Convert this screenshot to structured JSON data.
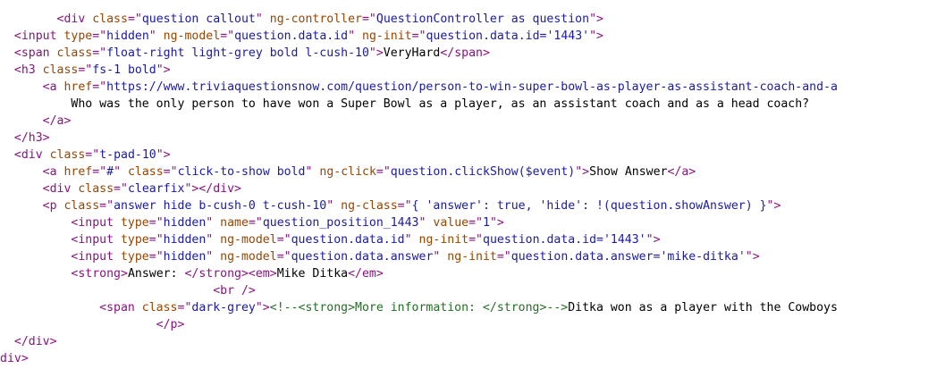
{
  "lines": [
    {
      "indent": "        ",
      "segs": [
        {
          "t": "tag",
          "v": "<div "
        },
        {
          "t": "attr",
          "v": "class"
        },
        {
          "t": "tag",
          "v": "=\""
        },
        {
          "t": "val",
          "v": "question callout"
        },
        {
          "t": "tag",
          "v": "\" "
        },
        {
          "t": "attr",
          "v": "ng-controller"
        },
        {
          "t": "tag",
          "v": "=\""
        },
        {
          "t": "val",
          "v": "QuestionController as question"
        },
        {
          "t": "tag",
          "v": "\">"
        }
      ]
    },
    {
      "indent": "  ",
      "segs": [
        {
          "t": "tag",
          "v": "<input "
        },
        {
          "t": "attr",
          "v": "type"
        },
        {
          "t": "tag",
          "v": "=\""
        },
        {
          "t": "val",
          "v": "hidden"
        },
        {
          "t": "tag",
          "v": "\" "
        },
        {
          "t": "attr",
          "v": "ng-model"
        },
        {
          "t": "tag",
          "v": "=\""
        },
        {
          "t": "val",
          "v": "question.data.id"
        },
        {
          "t": "tag",
          "v": "\" "
        },
        {
          "t": "attr",
          "v": "ng-init"
        },
        {
          "t": "tag",
          "v": "=\""
        },
        {
          "t": "val",
          "v": "question.data.id='1443'"
        },
        {
          "t": "tag",
          "v": "\">"
        }
      ]
    },
    {
      "indent": "  ",
      "segs": [
        {
          "t": "tag",
          "v": "<span "
        },
        {
          "t": "attr",
          "v": "class"
        },
        {
          "t": "tag",
          "v": "=\""
        },
        {
          "t": "val",
          "v": "float-right light-grey bold l-cush-10"
        },
        {
          "t": "tag",
          "v": "\">"
        },
        {
          "t": "txt",
          "v": "VeryHard"
        },
        {
          "t": "tag",
          "v": "</span>"
        }
      ]
    },
    {
      "indent": "  ",
      "segs": [
        {
          "t": "tag",
          "v": "<h3 "
        },
        {
          "t": "attr",
          "v": "class"
        },
        {
          "t": "tag",
          "v": "=\""
        },
        {
          "t": "val",
          "v": "fs-1 bold"
        },
        {
          "t": "tag",
          "v": "\">"
        }
      ]
    },
    {
      "indent": "      ",
      "segs": [
        {
          "t": "tag",
          "v": "<a "
        },
        {
          "t": "attr",
          "v": "href"
        },
        {
          "t": "tag",
          "v": "=\""
        },
        {
          "t": "val",
          "v": "https://www.triviaquestionsnow.com/question/person-to-win-super-bowl-as-player-as-assistant-coach-and-a"
        }
      ]
    },
    {
      "indent": "          ",
      "segs": [
        {
          "t": "txt",
          "v": "Who was the only person to have won a Super Bowl as a player, as an assistant coach and as a head coach?"
        }
      ]
    },
    {
      "indent": "      ",
      "segs": [
        {
          "t": "tag",
          "v": "</a>"
        }
      ]
    },
    {
      "indent": "  ",
      "segs": [
        {
          "t": "tag",
          "v": "</h3>"
        }
      ]
    },
    {
      "indent": "  ",
      "segs": [
        {
          "t": "tag",
          "v": "<div "
        },
        {
          "t": "attr",
          "v": "class"
        },
        {
          "t": "tag",
          "v": "=\""
        },
        {
          "t": "val",
          "v": "t-pad-10"
        },
        {
          "t": "tag",
          "v": "\">"
        }
      ]
    },
    {
      "indent": "      ",
      "segs": [
        {
          "t": "tag",
          "v": "<a "
        },
        {
          "t": "attr",
          "v": "href"
        },
        {
          "t": "tag",
          "v": "=\""
        },
        {
          "t": "val",
          "v": "#"
        },
        {
          "t": "tag",
          "v": "\" "
        },
        {
          "t": "attr",
          "v": "class"
        },
        {
          "t": "tag",
          "v": "=\""
        },
        {
          "t": "val",
          "v": "click-to-show bold"
        },
        {
          "t": "tag",
          "v": "\" "
        },
        {
          "t": "attr",
          "v": "ng-click"
        },
        {
          "t": "tag",
          "v": "=\""
        },
        {
          "t": "val",
          "v": "question.clickShow($event)"
        },
        {
          "t": "tag",
          "v": "\">"
        },
        {
          "t": "txt",
          "v": "Show Answer"
        },
        {
          "t": "tag",
          "v": "</a>"
        }
      ]
    },
    {
      "indent": "      ",
      "segs": [
        {
          "t": "tag",
          "v": "<div "
        },
        {
          "t": "attr",
          "v": "class"
        },
        {
          "t": "tag",
          "v": "=\""
        },
        {
          "t": "val",
          "v": "clearfix"
        },
        {
          "t": "tag",
          "v": "\"></div>"
        }
      ]
    },
    {
      "indent": "      ",
      "segs": [
        {
          "t": "tag",
          "v": "<p "
        },
        {
          "t": "attr",
          "v": "class"
        },
        {
          "t": "tag",
          "v": "=\""
        },
        {
          "t": "val",
          "v": "answer hide b-cush-0 t-cush-10"
        },
        {
          "t": "tag",
          "v": "\" "
        },
        {
          "t": "attr",
          "v": "ng-class"
        },
        {
          "t": "tag",
          "v": "=\""
        },
        {
          "t": "val",
          "v": "{ 'answer': true, 'hide': !(question.showAnswer) }"
        },
        {
          "t": "tag",
          "v": "\">"
        }
      ]
    },
    {
      "indent": "          ",
      "segs": [
        {
          "t": "tag",
          "v": "<input "
        },
        {
          "t": "attr",
          "v": "type"
        },
        {
          "t": "tag",
          "v": "=\""
        },
        {
          "t": "val",
          "v": "hidden"
        },
        {
          "t": "tag",
          "v": "\" "
        },
        {
          "t": "attr",
          "v": "name"
        },
        {
          "t": "tag",
          "v": "=\""
        },
        {
          "t": "val",
          "v": "question_position_1443"
        },
        {
          "t": "tag",
          "v": "\" "
        },
        {
          "t": "attr",
          "v": "value"
        },
        {
          "t": "tag",
          "v": "=\""
        },
        {
          "t": "val",
          "v": "1"
        },
        {
          "t": "tag",
          "v": "\">"
        }
      ]
    },
    {
      "indent": "          ",
      "segs": [
        {
          "t": "tag",
          "v": "<input "
        },
        {
          "t": "attr",
          "v": "type"
        },
        {
          "t": "tag",
          "v": "=\""
        },
        {
          "t": "val",
          "v": "hidden"
        },
        {
          "t": "tag",
          "v": "\" "
        },
        {
          "t": "attr",
          "v": "ng-model"
        },
        {
          "t": "tag",
          "v": "=\""
        },
        {
          "t": "val",
          "v": "question.data.id"
        },
        {
          "t": "tag",
          "v": "\" "
        },
        {
          "t": "attr",
          "v": "ng-init"
        },
        {
          "t": "tag",
          "v": "=\""
        },
        {
          "t": "val",
          "v": "question.data.id='1443'"
        },
        {
          "t": "tag",
          "v": "\">"
        }
      ]
    },
    {
      "indent": "          ",
      "segs": [
        {
          "t": "tag",
          "v": "<input "
        },
        {
          "t": "attr",
          "v": "type"
        },
        {
          "t": "tag",
          "v": "=\""
        },
        {
          "t": "val",
          "v": "hidden"
        },
        {
          "t": "tag",
          "v": "\" "
        },
        {
          "t": "attr",
          "v": "ng-model"
        },
        {
          "t": "tag",
          "v": "=\""
        },
        {
          "t": "val",
          "v": "question.data.answer"
        },
        {
          "t": "tag",
          "v": "\" "
        },
        {
          "t": "attr",
          "v": "ng-init"
        },
        {
          "t": "tag",
          "v": "=\""
        },
        {
          "t": "val",
          "v": "question.data.answer='mike-ditka'"
        },
        {
          "t": "tag",
          "v": "\">"
        }
      ]
    },
    {
      "indent": "          ",
      "segs": [
        {
          "t": "tag",
          "v": "<strong>"
        },
        {
          "t": "txt",
          "v": "Answer: "
        },
        {
          "t": "tag",
          "v": "</strong><em>"
        },
        {
          "t": "txt",
          "v": "Mike Ditka"
        },
        {
          "t": "tag",
          "v": "</em>"
        }
      ]
    },
    {
      "indent": "                              ",
      "segs": [
        {
          "t": "tag",
          "v": "<br />"
        }
      ]
    },
    {
      "indent": "              ",
      "segs": [
        {
          "t": "tag",
          "v": "<span "
        },
        {
          "t": "attr",
          "v": "class"
        },
        {
          "t": "tag",
          "v": "=\""
        },
        {
          "t": "val",
          "v": "dark-grey"
        },
        {
          "t": "tag",
          "v": "\">"
        },
        {
          "t": "cm",
          "v": "<!--<strong>More information: </strong>-->"
        },
        {
          "t": "txt",
          "v": "Ditka won as a player with the Cowboys"
        }
      ]
    },
    {
      "indent": "                      ",
      "segs": [
        {
          "t": "tag",
          "v": "</p>"
        }
      ]
    },
    {
      "indent": "  ",
      "segs": [
        {
          "t": "tag",
          "v": "</div>"
        }
      ]
    },
    {
      "indent": "",
      "segs": [
        {
          "t": "tag",
          "v": "div>"
        }
      ]
    }
  ]
}
